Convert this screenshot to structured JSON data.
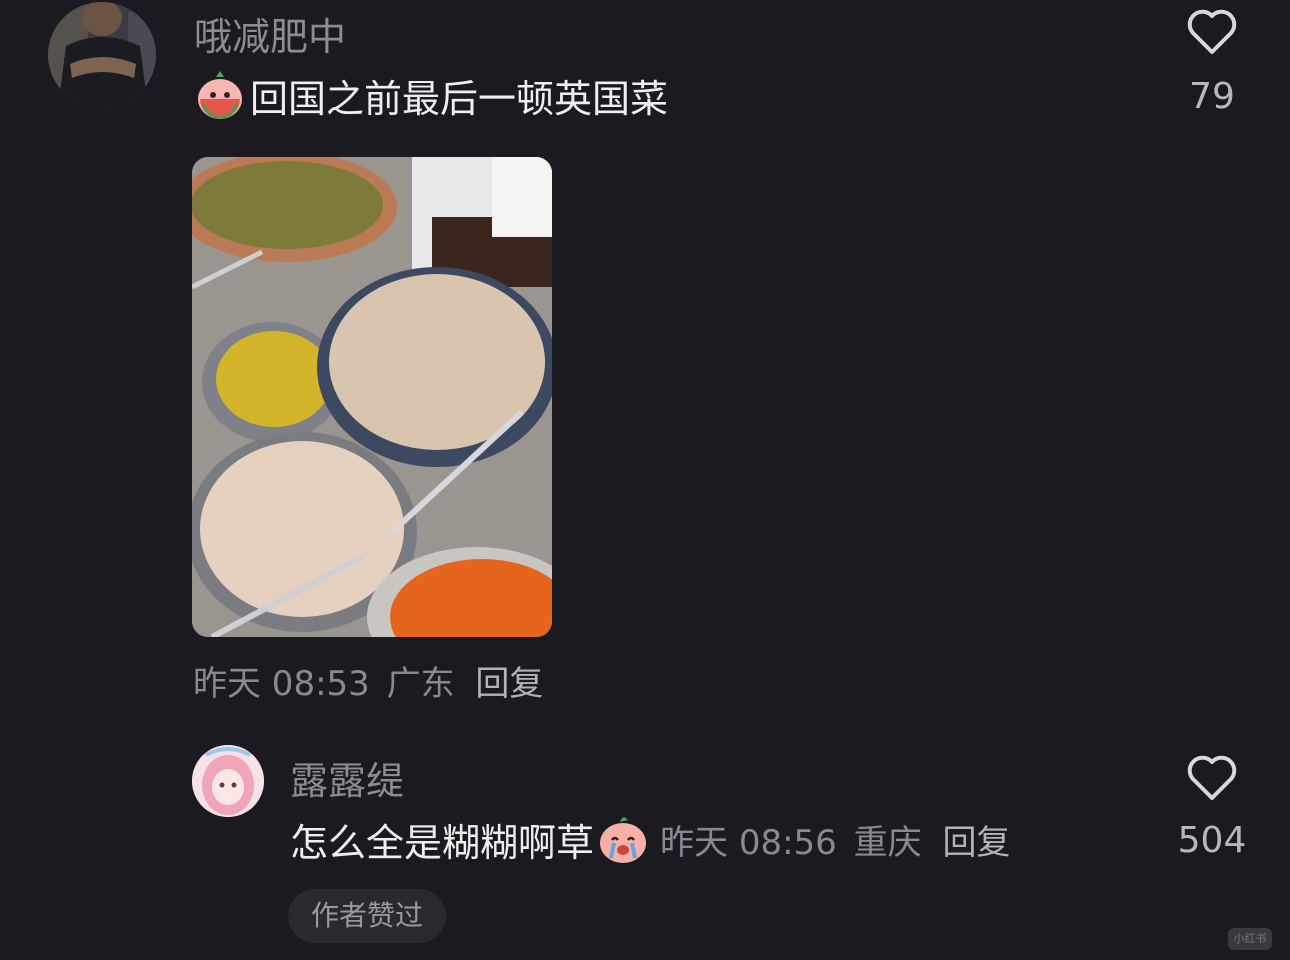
{
  "comments": [
    {
      "username": "哦减肥中",
      "text": "回国之前最后一顿英国菜",
      "emoji": "watermelon-sticker-icon",
      "time": "昨天 08:53",
      "location": "广东",
      "reply_label": "回复",
      "likes": "79",
      "image": "buffet-salad-photo"
    },
    {
      "username": "露露缇",
      "text": "怎么全是糊糊啊草",
      "emoji": "crying-peach-sticker-icon",
      "time": "昨天 08:56",
      "location": "重庆",
      "reply_label": "回复",
      "likes": "504",
      "badge": "作者赞过"
    }
  ],
  "watermark": "小红书",
  "colors": {
    "background": "#1b1a20",
    "text": "#efefef",
    "muted": "#8a8990"
  }
}
